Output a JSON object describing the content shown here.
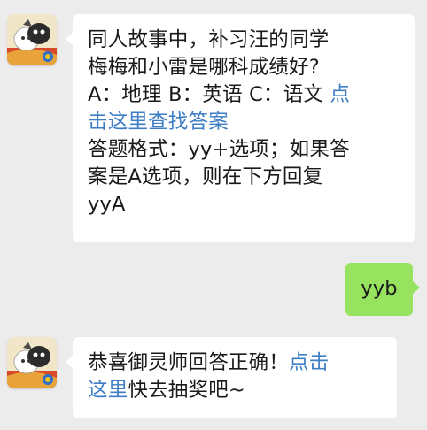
{
  "colors": {
    "background": "#ececec",
    "incoming_bubble": "#ffffff",
    "outgoing_bubble": "#97e35f",
    "link": "#3d7ec5"
  },
  "messages": [
    {
      "sender": "official-account",
      "avatar_icon": "onmyoji-game-avatar-icon",
      "lines": [
        [
          {
            "text": "同人故事中，补习汪的同学"
          }
        ],
        [
          {
            "text": "梅梅和小雷是哪科成绩好?"
          }
        ],
        [
          {
            "text": "A：地理 B：英语 C：语文 "
          },
          {
            "text": "点",
            "link": true
          }
        ],
        [
          {
            "text": "击这里查找答案",
            "link": true
          }
        ],
        [
          {
            "text": "答题格式：yy+选项；如果答"
          }
        ],
        [
          {
            "text": "案是A选项，则在下方回复"
          }
        ],
        [
          {
            "text": "yyA"
          }
        ]
      ]
    },
    {
      "sender": "me",
      "text": "yyb"
    },
    {
      "sender": "official-account",
      "avatar_icon": "onmyoji-game-avatar-icon",
      "lines": [
        [
          {
            "text": "恭喜御灵师回答正确！"
          },
          {
            "text": "点击",
            "link": true
          }
        ],
        [
          {
            "text": "这里",
            "link": true
          },
          {
            "text": "快去抽奖吧~"
          }
        ]
      ]
    }
  ]
}
